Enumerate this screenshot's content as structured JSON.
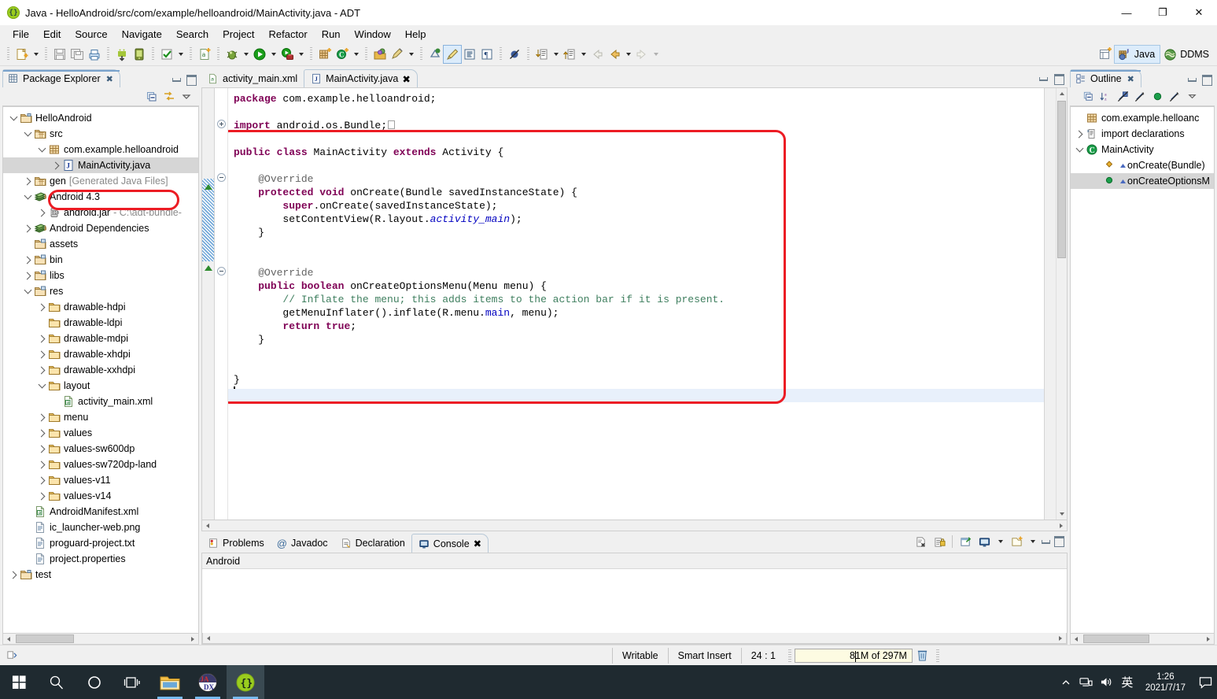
{
  "window": {
    "title": "Java - HelloAndroid/src/com/example/helloandroid/MainActivity.java - ADT",
    "app_icon": "braces-icon",
    "minimize": "—",
    "maximize": "❐",
    "close": "✕"
  },
  "menubar": {
    "items": [
      "File",
      "Edit",
      "Source",
      "Navigate",
      "Search",
      "Project",
      "Refactor",
      "Run",
      "Window",
      "Help"
    ]
  },
  "toolbar": {
    "groups": [
      {
        "icons": [
          "new-file-icon"
        ],
        "dropdown": true
      },
      {
        "icons": [
          "save-icon",
          "save-all-icon",
          "print-icon"
        ],
        "dropdown": false
      },
      {
        "icons": [
          "android-sdk-manager-icon",
          "android-avd-manager-icon"
        ],
        "dropdown": false
      },
      {
        "icons": [
          "check-build-icon"
        ],
        "dropdown": true
      },
      {
        "icons": [
          "new-android-xml-icon"
        ],
        "dropdown": false
      },
      {
        "icons": [
          "debug-icon"
        ],
        "dropdown": true
      },
      {
        "icons": [
          "run-icon"
        ],
        "dropdown": true
      },
      {
        "icons": [
          "external-tools-icon"
        ],
        "dropdown": true
      },
      {
        "icons": [
          "new-java-package-icon",
          "new-java-class-icon"
        ],
        "dropdown": true
      },
      {
        "icons": [
          "open-type-icon",
          "search-marker-icon"
        ],
        "dropdown": true
      },
      {
        "icons": [
          "next-annotation-icon",
          "toggle-mark-occurrences-icon",
          "show-whitespace-icon",
          "show-formatter-icon"
        ],
        "dropdown": false
      },
      {
        "icons": [
          "skip-breakpoints-icon"
        ],
        "dropdown": false
      },
      {
        "icons": [
          "next-edit-icon"
        ],
        "dropdown": true
      },
      {
        "icons": [
          "previous-edit-icon"
        ],
        "dropdown": true
      },
      {
        "icons": [
          "back-icon"
        ],
        "dropdown": false
      },
      {
        "icons": [
          "back-history-icon"
        ],
        "dropdown": true
      },
      {
        "icons": [
          "forward-icon"
        ],
        "dropdown": true
      }
    ],
    "perspective": {
      "open_perspective_icon": "open-perspective-icon",
      "items": [
        {
          "label": "Java",
          "icon": "java-perspective-icon",
          "active": true
        },
        {
          "label": "DDMS",
          "icon": "ddms-perspective-icon",
          "active": false
        }
      ]
    }
  },
  "package_explorer": {
    "tab_label": "Package Explorer",
    "tab_icon": "package-explorer-icon",
    "close_icon": "✖",
    "toolbar_icons": [
      "collapse-all-icon",
      "link-with-editor-icon",
      "view-menu-icon"
    ],
    "minimize_icon": "minimize-icon",
    "maximize_icon": "maximize-icon",
    "tree": [
      {
        "label": "HelloAndroid",
        "icon": "java-project-icon",
        "indent": 0,
        "twisty": "open"
      },
      {
        "label": "src",
        "icon": "source-folder-icon",
        "indent": 1,
        "twisty": "open"
      },
      {
        "label": "com.example.helloandroid",
        "icon": "package-icon",
        "indent": 2,
        "twisty": "open"
      },
      {
        "label": "MainActivity.java",
        "icon": "java-file-icon",
        "indent": 3,
        "twisty": "closed",
        "selected": true,
        "highlighted": true
      },
      {
        "label": "gen",
        "sub": "[Generated Java Files]",
        "icon": "source-folder-icon",
        "indent": 1,
        "twisty": "closed"
      },
      {
        "label": "Android 4.3",
        "icon": "library-icon",
        "indent": 1,
        "twisty": "open"
      },
      {
        "label": "android.jar",
        "sub": "- C:\\adt-bundle-",
        "icon": "jar-icon",
        "indent": 2,
        "twisty": "closed"
      },
      {
        "label": "Android Dependencies",
        "icon": "library-icon",
        "indent": 1,
        "twisty": "closed"
      },
      {
        "label": "assets",
        "icon": "folder-res-icon",
        "indent": 1,
        "twisty": "none"
      },
      {
        "label": "bin",
        "icon": "folder-res-icon",
        "indent": 1,
        "twisty": "closed"
      },
      {
        "label": "libs",
        "icon": "folder-res-icon",
        "indent": 1,
        "twisty": "closed"
      },
      {
        "label": "res",
        "icon": "folder-res-icon",
        "indent": 1,
        "twisty": "open"
      },
      {
        "label": "drawable-hdpi",
        "icon": "folder-icon",
        "indent": 2,
        "twisty": "closed"
      },
      {
        "label": "drawable-ldpi",
        "icon": "folder-icon",
        "indent": 2,
        "twisty": "none"
      },
      {
        "label": "drawable-mdpi",
        "icon": "folder-icon",
        "indent": 2,
        "twisty": "closed"
      },
      {
        "label": "drawable-xhdpi",
        "icon": "folder-icon",
        "indent": 2,
        "twisty": "closed"
      },
      {
        "label": "drawable-xxhdpi",
        "icon": "folder-icon",
        "indent": 2,
        "twisty": "closed"
      },
      {
        "label": "layout",
        "icon": "folder-icon",
        "indent": 2,
        "twisty": "open"
      },
      {
        "label": "activity_main.xml",
        "icon": "android-xml-icon",
        "indent": 3,
        "twisty": "none"
      },
      {
        "label": "menu",
        "icon": "folder-icon",
        "indent": 2,
        "twisty": "closed"
      },
      {
        "label": "values",
        "icon": "folder-icon",
        "indent": 2,
        "twisty": "closed"
      },
      {
        "label": "values-sw600dp",
        "icon": "folder-icon",
        "indent": 2,
        "twisty": "closed"
      },
      {
        "label": "values-sw720dp-land",
        "icon": "folder-icon",
        "indent": 2,
        "twisty": "closed"
      },
      {
        "label": "values-v11",
        "icon": "folder-icon",
        "indent": 2,
        "twisty": "closed"
      },
      {
        "label": "values-v14",
        "icon": "folder-icon",
        "indent": 2,
        "twisty": "closed"
      },
      {
        "label": "AndroidManifest.xml",
        "icon": "android-xml-icon",
        "indent": 1,
        "twisty": "none"
      },
      {
        "label": "ic_launcher-web.png",
        "icon": "file-icon",
        "indent": 1,
        "twisty": "none"
      },
      {
        "label": "proguard-project.txt",
        "icon": "file-icon",
        "indent": 1,
        "twisty": "none"
      },
      {
        "label": "project.properties",
        "icon": "file-icon",
        "indent": 1,
        "twisty": "none"
      },
      {
        "label": "test",
        "icon": "java-project-icon",
        "indent": 0,
        "twisty": "closed"
      }
    ]
  },
  "editor": {
    "tabs": [
      {
        "label": "activity_main.xml",
        "icon": "android-xml-icon",
        "active": false,
        "closeable": false
      },
      {
        "label": "MainActivity.java",
        "icon": "java-file-icon",
        "active": true,
        "closeable": true,
        "close_icon": "✖"
      }
    ],
    "minimize_icon": "minimize-icon",
    "maximize_icon": "maximize-icon",
    "highlight_color": "#ec1c24",
    "code_lines": [
      {
        "indent": 0,
        "tokens": [
          {
            "t": "package",
            "c": "kw"
          },
          {
            "t": " com.example.helloandroid;",
            "c": ""
          }
        ]
      },
      {
        "indent": 0,
        "tokens": []
      },
      {
        "indent": 0,
        "tokens": [
          {
            "t": "import",
            "c": "kw"
          },
          {
            "t": " android.os.Bundle;",
            "c": ""
          }
        ],
        "fold": "plus",
        "collapsed_marker": true
      },
      {
        "indent": 0,
        "tokens": []
      },
      {
        "indent": 0,
        "tokens": [
          {
            "t": "public",
            "c": "kw"
          },
          {
            "t": " ",
            "c": ""
          },
          {
            "t": "class",
            "c": "kw"
          },
          {
            "t": " MainActivity ",
            "c": ""
          },
          {
            "t": "extends",
            "c": "kw"
          },
          {
            "t": " Activity {",
            "c": ""
          }
        ]
      },
      {
        "indent": 0,
        "tokens": []
      },
      {
        "indent": 1,
        "tokens": [
          {
            "t": "@Override",
            "c": "ann"
          }
        ],
        "fold": "minus"
      },
      {
        "indent": 1,
        "tokens": [
          {
            "t": "protected",
            "c": "kw"
          },
          {
            "t": " ",
            "c": ""
          },
          {
            "t": "void",
            "c": "kw"
          },
          {
            "t": " onCreate(Bundle savedInstanceState) {",
            "c": ""
          }
        ]
      },
      {
        "indent": 2,
        "tokens": [
          {
            "t": "super",
            "c": "kw"
          },
          {
            "t": ".onCreate(savedInstanceState);",
            "c": ""
          }
        ]
      },
      {
        "indent": 2,
        "tokens": [
          {
            "t": "setContentView(R.layout.",
            "c": ""
          },
          {
            "t": "activity_main",
            "c": "fld"
          },
          {
            "t": ");",
            "c": ""
          }
        ]
      },
      {
        "indent": 1,
        "tokens": [
          {
            "t": "}",
            "c": ""
          }
        ]
      },
      {
        "indent": 0,
        "tokens": []
      },
      {
        "indent": 0,
        "tokens": []
      },
      {
        "indent": 1,
        "tokens": [
          {
            "t": "@Override",
            "c": "ann"
          }
        ],
        "fold": "minus"
      },
      {
        "indent": 1,
        "tokens": [
          {
            "t": "public",
            "c": "kw"
          },
          {
            "t": " ",
            "c": ""
          },
          {
            "t": "boolean",
            "c": "kw"
          },
          {
            "t": " onCreateOptionsMenu(Menu menu) {",
            "c": ""
          }
        ]
      },
      {
        "indent": 2,
        "tokens": [
          {
            "t": "// Inflate the menu; this adds items to the action bar if it is present.",
            "c": "cmt"
          }
        ]
      },
      {
        "indent": 2,
        "tokens": [
          {
            "t": "getMenuInflater().inflate(R.menu.",
            "c": ""
          },
          {
            "t": "main",
            "c": "stat"
          },
          {
            "t": ", menu);",
            "c": ""
          }
        ]
      },
      {
        "indent": 2,
        "tokens": [
          {
            "t": "return",
            "c": "kw"
          },
          {
            "t": " ",
            "c": ""
          },
          {
            "t": "true",
            "c": "kw"
          },
          {
            "t": ";",
            "c": ""
          }
        ]
      },
      {
        "indent": 1,
        "tokens": [
          {
            "t": "}",
            "c": ""
          }
        ]
      },
      {
        "indent": 0,
        "tokens": []
      },
      {
        "indent": 0,
        "tokens": []
      },
      {
        "indent": 0,
        "tokens": [
          {
            "t": "}",
            "c": ""
          }
        ]
      },
      {
        "indent": 0,
        "tokens": [],
        "cursor": true
      }
    ]
  },
  "bottom_panel": {
    "tabs": [
      {
        "label": "Problems",
        "icon": "problems-icon",
        "active": false
      },
      {
        "label": "Javadoc",
        "icon": "javadoc-icon",
        "active": false
      },
      {
        "label": "Declaration",
        "icon": "declaration-icon",
        "active": false
      },
      {
        "label": "Console",
        "icon": "console-icon",
        "active": true,
        "close_icon": "✖"
      }
    ],
    "toolbar_icons": [
      "clear-console-icon",
      "scroll-lock-icon",
      "pin-console-icon",
      "display-console-icon",
      "open-console-icon"
    ],
    "minimize_icon": "minimize-icon",
    "maximize_icon": "maximize-icon",
    "content_title": "Android",
    "content_lines": []
  },
  "outline": {
    "tab_label": "Outline",
    "tab_icon": "outline-icon",
    "close_icon": "✖",
    "toolbar_icons": [
      "collapse-all-icon",
      "sort-icon",
      "hide-fields-icon",
      "hide-static-icon",
      "hide-nonpublic-icon",
      "hide-local-types-icon",
      "view-menu-icon"
    ],
    "minimize_icon": "minimize-icon",
    "maximize_icon": "maximize-icon",
    "tree": [
      {
        "label": "com.example.helloanc",
        "icon": "package-icon",
        "indent": 0,
        "twisty": "none"
      },
      {
        "label": "import declarations",
        "icon": "import-icon",
        "indent": 0,
        "twisty": "closed"
      },
      {
        "label": "MainActivity",
        "icon": "class-icon",
        "indent": 0,
        "twisty": "open"
      },
      {
        "label": "onCreate(Bundle)",
        "icon": "method-protected-icon",
        "indent": 1,
        "twisty": "none",
        "overrides": true
      },
      {
        "label": "onCreateOptionsM",
        "icon": "method-public-icon",
        "indent": 1,
        "twisty": "none",
        "overrides": true,
        "selected": true
      }
    ]
  },
  "statusbar": {
    "writable": "Writable",
    "insert_mode": "Smart Insert",
    "position": "24 : 1",
    "memory": "81M of 297M",
    "trash_icon": "trash-icon",
    "left_icon": "editor-status-icon"
  },
  "taskbar": {
    "start_icon": "windows-start-icon",
    "search_icon": "search-icon",
    "cortana_icon": "cortana-circle-icon",
    "taskview_icon": "task-view-icon",
    "apps": [
      {
        "name": "file-explorer-icon",
        "running": true,
        "active": false
      },
      {
        "name": "jadx-icon",
        "running": true,
        "active": false
      },
      {
        "name": "eclipse-adt-icon",
        "running": true,
        "active": true
      }
    ],
    "tray": {
      "chevron_icon": "show-hidden-icons-icon",
      "network_icon": "network-icon",
      "volume_icon": "volume-icon",
      "ime_label": "英",
      "time": "1:26",
      "date": "2021/7/17",
      "notification_icon": "action-center-icon"
    }
  }
}
